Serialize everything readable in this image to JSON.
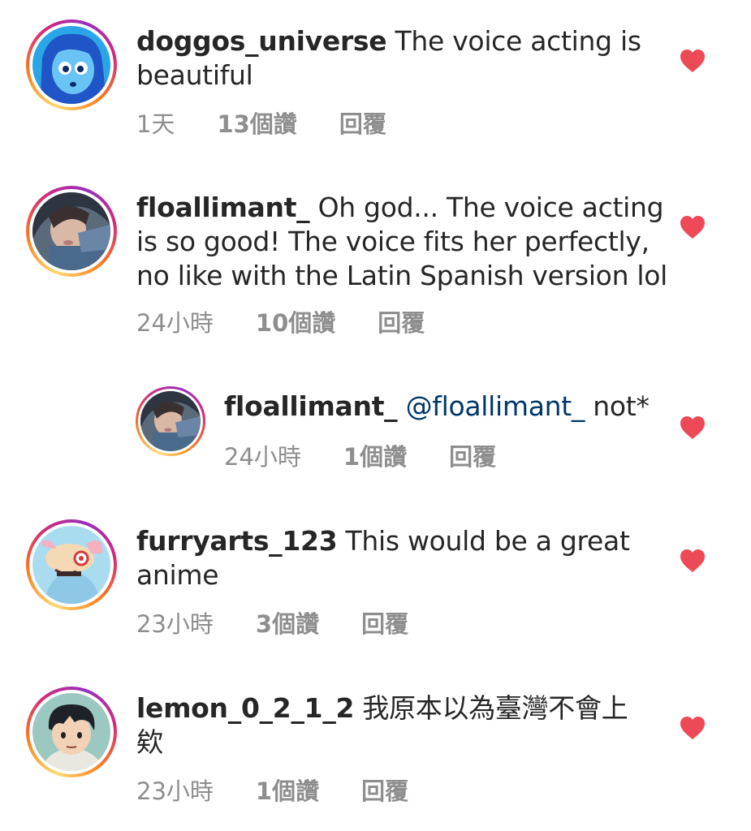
{
  "comments": [
    {
      "username": "doggos_universe",
      "text_line1": " The voice acting is",
      "text_line2": "beautiful",
      "text_line3": "",
      "time": "1天",
      "likes": "13個讚",
      "reply": "回覆",
      "avatar_icon": "lapis-character-avatar"
    },
    {
      "username": "floallimant_",
      "text_line1": " Oh god... The voice acting",
      "text_line2": "is so good! The voice fits her perfectly,",
      "text_line3": "no like with the Latin Spanish version lol",
      "time": "24小時",
      "likes": "10個讚",
      "reply": "回覆",
      "avatar_icon": "selfie-avatar"
    },
    {
      "username": "floallimant_",
      "mention": "@floallimant_",
      "text_line1": " not*",
      "time": "24小時",
      "likes": "1個讚",
      "reply": "回覆",
      "avatar_icon": "selfie-avatar"
    },
    {
      "username": "furryarts_123",
      "text_line1": " This would be a great",
      "text_line2": "anime",
      "text_line3": "",
      "time": "23小時",
      "likes": "3個讚",
      "reply": "回覆",
      "avatar_icon": "furry-character-avatar"
    },
    {
      "username": "lemon_0_2_1_2",
      "text_line1": " 我原本以為臺灣不會上",
      "text_line2": "欸",
      "text_line3": "",
      "time": "23小時",
      "likes": "1個讚",
      "reply": "回覆",
      "avatar_icon": "anime-boy-avatar"
    }
  ],
  "colors": {
    "heart": "#ed4956",
    "meta_text": "#8e8e8e",
    "mention": "#00376b",
    "body_text": "#262626"
  }
}
